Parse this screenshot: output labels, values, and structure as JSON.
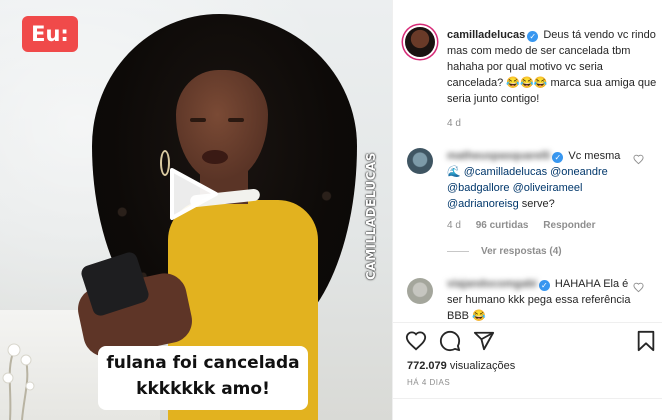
{
  "video": {
    "badge": "Eu:",
    "watermark": "CAMILLADELUCAS",
    "caption": [
      "fulana foi cancelada",
      "kkkkkkk amo!"
    ]
  },
  "post": {
    "username": "camilladelucas",
    "caption": "Deus tá vendo vc rindo mas com medo de ser cancelada tbm hahaha por qual motivo vc seria cancelada? 😂😂😂 marca sua amiga que seria junto contigo!",
    "age": "4 d"
  },
  "comments": [
    {
      "username": "matheuspasquarelli",
      "verified": true,
      "text_parts": [
        "Vc mesma",
        "🌊",
        "@camilladelucas",
        "@oneandre",
        "@badgallore",
        "@oliveirameel",
        "@adrianoreisg",
        "serve?"
      ],
      "age": "4 d",
      "likes": "96 curtidas",
      "reply": "Responder",
      "view_replies": "Ver respostas (4)"
    },
    {
      "username": "viajandocomgabi",
      "verified": true,
      "text": "HAHAHA Ela é ser humano kkk pega essa referência BBB 😂"
    }
  ],
  "footer": {
    "views": "772.079",
    "views_label": "visualizações",
    "date": "HÁ 4 DIAS"
  },
  "icons": [
    "heart-icon",
    "comment-icon",
    "share-icon",
    "bookmark-icon",
    "play-icon",
    "verified-icon"
  ],
  "colors": {
    "badge": "#f04a4a",
    "verified": "#3897f0",
    "mention": "#00376b",
    "muted": "#8e8e8e"
  }
}
